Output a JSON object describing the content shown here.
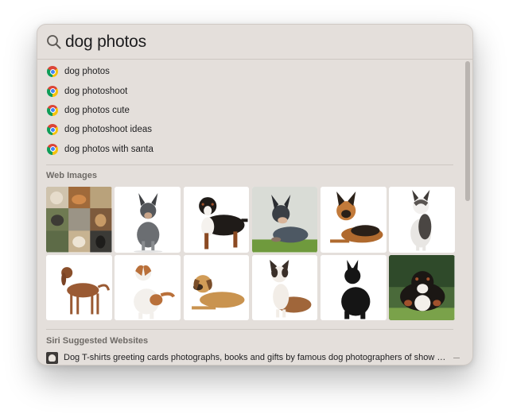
{
  "search": {
    "query": "dog photos"
  },
  "suggestions": [
    {
      "label": "dog photos",
      "icon": "chrome-icon"
    },
    {
      "label": "dog photoshoot",
      "icon": "chrome-icon"
    },
    {
      "label": "dog photos cute",
      "icon": "chrome-icon"
    },
    {
      "label": "dog photoshoot ideas",
      "icon": "chrome-icon"
    },
    {
      "label": "dog photos with santa",
      "icon": "chrome-icon"
    }
  ],
  "web_images": {
    "title": "Web Images",
    "images": [
      "dog-collage-image",
      "australian-cattle-dog-image",
      "bernese-mountain-dog-image",
      "blue-heeler-on-grass-image",
      "german-shepherd-lying-image",
      "husky-sitting-image",
      "spaniel-standing-image",
      "jack-russell-terrier-image",
      "mixed-breed-lying-image",
      "corgi-sitting-image",
      "scottish-terrier-image",
      "swiss-mountain-dog-image"
    ]
  },
  "siri_websites": {
    "title": "Siri Suggested Websites",
    "items": [
      {
        "label": "Dog T-shirts greeting cards photographs, books and gifts by famous dog photographers of show do...",
        "icon": "website-favicon-icon"
      }
    ]
  },
  "colors": {
    "panel": "#e4dfdb",
    "divider": "#cdc7c2",
    "section_title": "#6e6a66"
  }
}
